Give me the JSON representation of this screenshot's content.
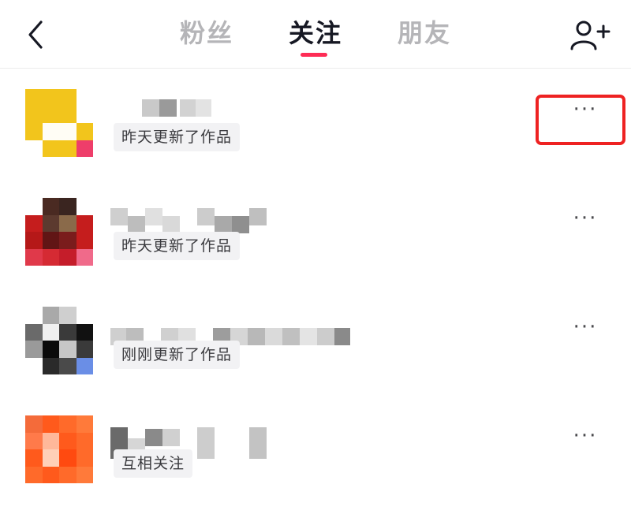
{
  "header": {
    "tabs": [
      {
        "label": "粉丝",
        "active": false
      },
      {
        "label": "关注",
        "active": true
      },
      {
        "label": "朋友",
        "active": false
      }
    ],
    "back_icon": "chevron-left-icon",
    "add_friend_icon": "add-user-icon",
    "accent_color": "#fe2c55"
  },
  "following": [
    {
      "status": "昨天更新了作品",
      "more_label": "···",
      "highlighted": true
    },
    {
      "status": "昨天更新了作品",
      "more_label": "···",
      "highlighted": false
    },
    {
      "status": "刚刚更新了作品",
      "more_label": "···",
      "highlighted": false
    },
    {
      "status": "互相关注",
      "more_label": "···",
      "highlighted": false
    }
  ],
  "highlight_color": "#ee2222"
}
